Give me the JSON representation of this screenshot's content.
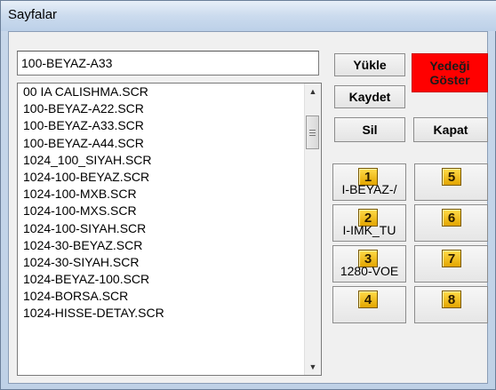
{
  "window": {
    "title": "Sayfalar"
  },
  "page_input": {
    "value": "100-BEYAZ-A33"
  },
  "buttons": {
    "load": "Yükle",
    "save": "Kaydet",
    "delete": "Sil",
    "close": "Kapat",
    "show_backup_line1": "Yedeği",
    "show_backup_line2": "Göster"
  },
  "file_list": [
    "00 IA CALISHMA.SCR",
    "100-BEYAZ-A22.SCR",
    "100-BEYAZ-A33.SCR",
    "100-BEYAZ-A44.SCR",
    "1024_100_SIYAH.SCR",
    "1024-100-BEYAZ.SCR",
    "1024-100-MXB.SCR",
    "1024-100-MXS.SCR",
    "1024-100-SIYAH.SCR",
    "1024-30-BEYAZ.SCR",
    "1024-30-SIYAH.SCR",
    "1024-BEYAZ-100.SCR",
    "1024-BORSA.SCR",
    "1024-HISSE-DETAY.SCR"
  ],
  "slots": {
    "s1": {
      "num": "1",
      "label": "I-BEYAZ-/"
    },
    "s2": {
      "num": "2",
      "label": "I-IMK_TU"
    },
    "s3": {
      "num": "3",
      "label": "1280-VOE"
    },
    "s4": {
      "num": "4",
      "label": ""
    },
    "s5": {
      "num": "5",
      "label": ""
    },
    "s6": {
      "num": "6",
      "label": ""
    },
    "s7": {
      "num": "7",
      "label": ""
    },
    "s8": {
      "num": "8",
      "label": ""
    }
  },
  "colors": {
    "backup_button": "#ff0000",
    "slot_badge": "#f0c020"
  },
  "icons": {
    "scroll_up": "scroll-up-arrow-icon",
    "scroll_down": "scroll-down-arrow-icon"
  }
}
